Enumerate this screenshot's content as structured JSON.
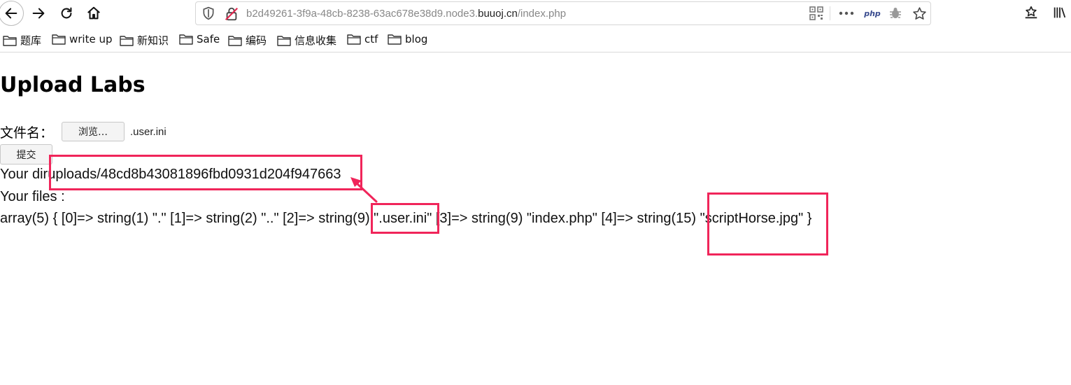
{
  "browser": {
    "url_prefix": "b2d49261-3f9a-48cb-8238-63ac678e38d9.node3.",
    "url_domain": "buuoj.cn",
    "url_path": "/index.php",
    "php_badge": "php"
  },
  "bookmarks": [
    {
      "label": "题库"
    },
    {
      "label": "write up"
    },
    {
      "label": "新知识"
    },
    {
      "label": "Safe"
    },
    {
      "label": "编码"
    },
    {
      "label": "信息收集"
    },
    {
      "label": "ctf"
    },
    {
      "label": "blog"
    }
  ],
  "page": {
    "title": "Upload Labs",
    "file_label": "文件名：",
    "browse_label": "浏览…",
    "selected_file": ".user.ini",
    "submit_label": "提交",
    "dir_prefix": "Your dir",
    "dir_value": "uploads/48cd8b43081896fbd0931d204f947663",
    "files_label": "Your files :",
    "dump": {
      "p1": "array(5) { [0]=> string(1) \".\" [1]=> string(2) \"..\" [2]=> string(9) ",
      "f1": "\".user.ini\"",
      "p2": " [3]=> string(9) \"index.php\" [4]=> string(15) ",
      "f2": "\"scriptHorse.jpg\"",
      "p3": " }"
    }
  },
  "colors": {
    "highlight": "#f0255a"
  }
}
